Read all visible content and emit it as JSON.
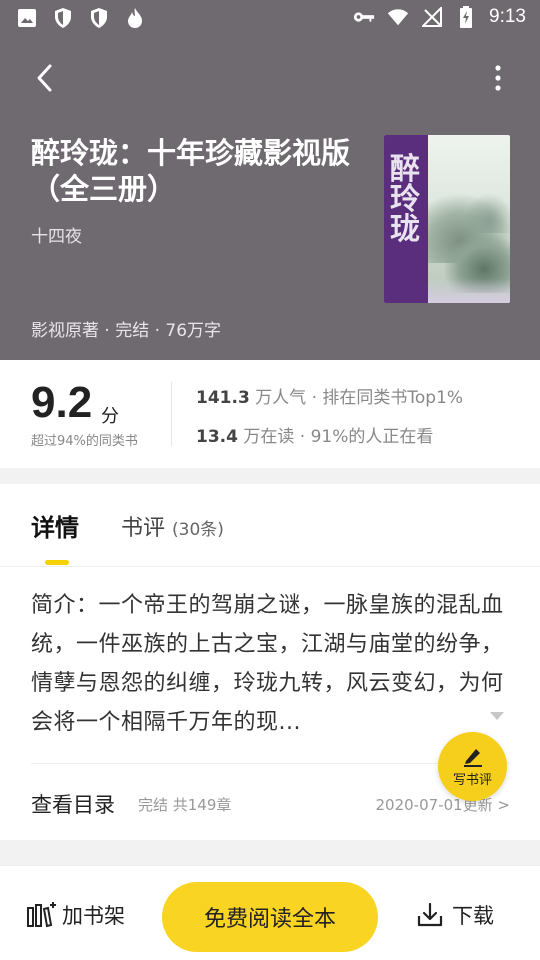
{
  "status_bar": {
    "time": "9:13"
  },
  "book": {
    "title": "醉玲珑：十年珍藏影视版（全三册）",
    "author": "十四夜",
    "meta": "影视原著 · 完结 · 76万字",
    "cover_title": "醉玲珑"
  },
  "rating": {
    "score": "9.2",
    "unit": "分",
    "subtitle": "超过94%的同类书",
    "popularity_num": "141.3",
    "popularity_text": "万人气 · 排在同类书Top1%",
    "reading_num": "13.4",
    "reading_text": "万在读 · 91%的人正在看"
  },
  "tabs": {
    "detail": "详情",
    "review": "书评",
    "review_count": "(30条)"
  },
  "intro": "简介：一个帝王的驾崩之谜，一脉皇族的混乱血统，一件巫族的上古之宝，江湖与庙堂的纷争，情孽与恩怨的纠缠，玲珑九转，风云变幻，为何会将一个相隔千万年的现...",
  "write_review_label": "写书评",
  "catalog": {
    "label": "查看目录",
    "status": "完结 共149章",
    "updated": "2020-07-01更新 >"
  },
  "bottom_bar": {
    "add_shelf": "加书架",
    "read_free": "免费阅读全本",
    "download": "下载"
  },
  "colors": {
    "header_bg": "#6f6a6f",
    "accent_yellow": "#f9d423"
  }
}
